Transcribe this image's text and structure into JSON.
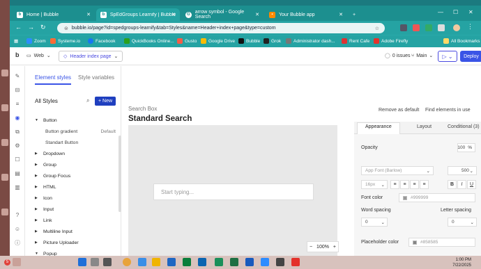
{
  "browser": {
    "tabs": [
      {
        "label": "Home | Bubble",
        "icon": "bubble-icon"
      },
      {
        "label": "SpEdGroups Learnify | Bubble E",
        "icon": "bubble-icon"
      },
      {
        "label": "arrow symbol - Google Search",
        "icon": "google-icon"
      },
      {
        "label": "Your Bubble app",
        "icon": "page-icon"
      }
    ],
    "new_tab": "+",
    "url": "bubble.io/page?id=spedgroups-learnify&tab=Styles&name=Header+index+page&type=custom",
    "bookmarks": [
      "Zoom",
      "Systeme.io",
      "Facebook",
      "QuickBooks Online...",
      "Gusto",
      "Google Drive",
      "Bubble",
      "Grok",
      "Administrator dash...",
      "Rent Cafe",
      "Adobe Firefly"
    ],
    "all_bookmarks": "All Bookmarks"
  },
  "editor": {
    "logo": "b",
    "device": "Web",
    "page": "Header index page",
    "issues": "0 issues",
    "branch": "Main",
    "deploy": "Deploy"
  },
  "styles_panel": {
    "tab_active": "Element styles",
    "tab_other": "Style variables",
    "heading": "All Styles",
    "new_button": "New",
    "rows": [
      {
        "label": "Button",
        "expanded": true,
        "child": false
      },
      {
        "label": "Button gradient",
        "child": true,
        "default": "Default"
      },
      {
        "label": "Standart Button",
        "child": true
      },
      {
        "label": "Dropdown",
        "child": false
      },
      {
        "label": "Group",
        "child": false
      },
      {
        "label": "Group Focus",
        "child": false
      },
      {
        "label": "HTML",
        "child": false
      },
      {
        "label": "Icon",
        "child": false
      },
      {
        "label": "Input",
        "child": false
      },
      {
        "label": "Link",
        "child": false
      },
      {
        "label": "Multiline Input",
        "child": false
      },
      {
        "label": "Picture Uploader",
        "child": false
      },
      {
        "label": "Popup",
        "expanded": true,
        "child": false
      }
    ]
  },
  "canvas": {
    "label": "Search Box",
    "title": "Standard Search",
    "input_placeholder": "Start typing...",
    "zoom": "100%"
  },
  "property": {
    "remove_default": "Remove as default",
    "find": "Find elements in use",
    "tabs": [
      "Appearance",
      "Layout",
      "Conditional (3)"
    ],
    "opacity_label": "Opacity",
    "opacity_value": "100",
    "opacity_unit": "%",
    "font": "App Font (Barlow)",
    "weight": "500",
    "font_size": "16px",
    "font_color_label": "Font color",
    "font_color": "#999999",
    "word_spacing_label": "Word spacing",
    "letter_spacing_label": "Letter spacing",
    "word_spacing": "0",
    "letter_spacing": "0",
    "placeholder_label": "Placeholder color",
    "placeholder_color": "#858585"
  },
  "taskbar": {
    "time": "1:00 PM",
    "date": "7/22/2025",
    "badge_count": "5"
  },
  "colors": {
    "browser_teal": "#1c8f8f",
    "accent": "#3a54e6"
  }
}
